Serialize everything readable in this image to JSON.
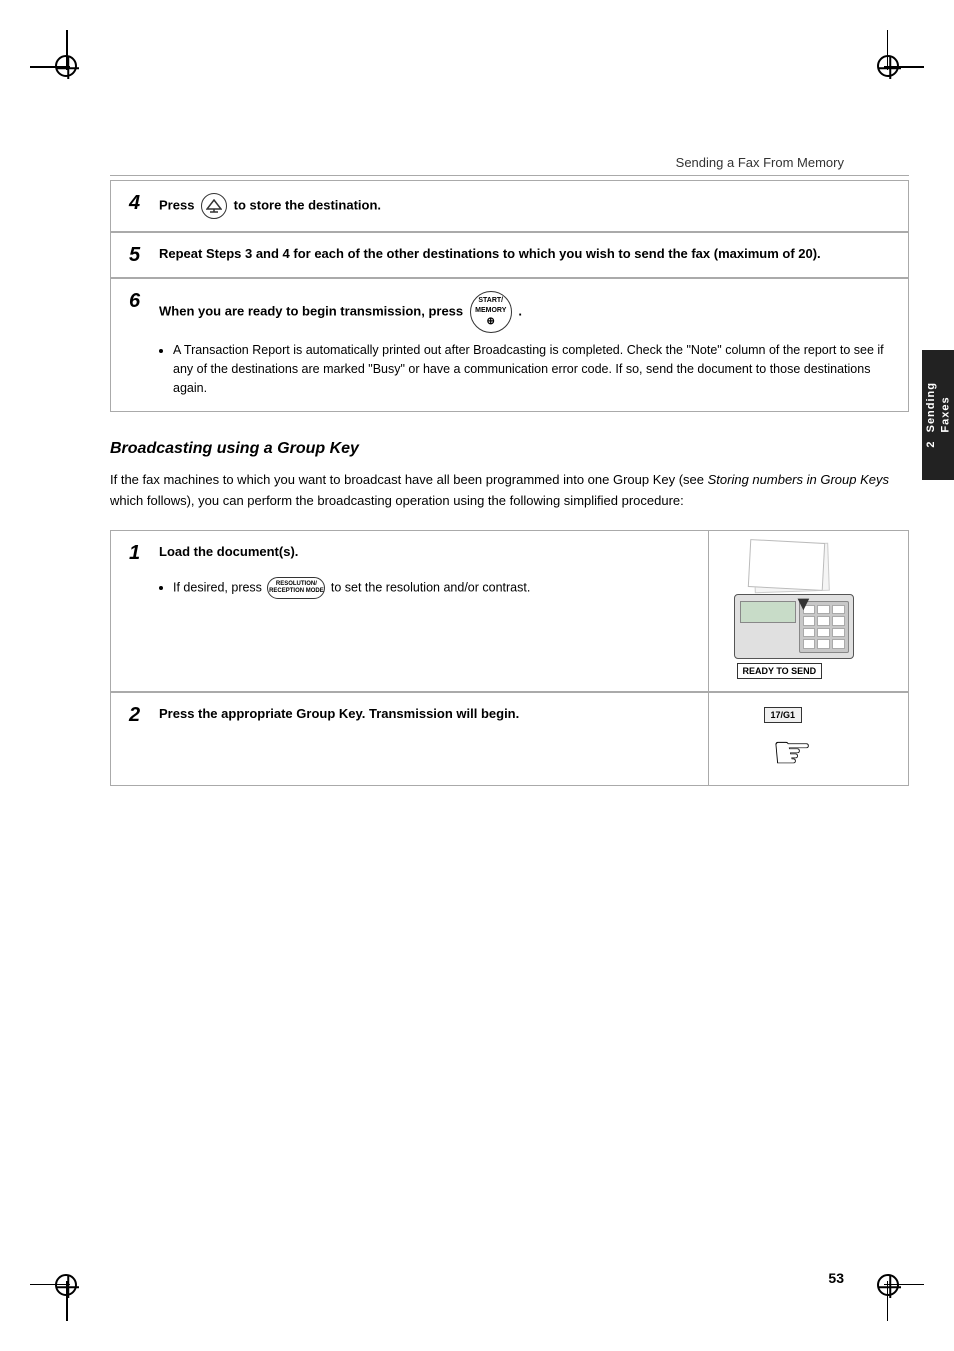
{
  "page": {
    "title": "Sending a Fax From Memory",
    "page_number": "53",
    "side_tab": "2  Sending\nFaxes"
  },
  "step4": {
    "number": "4",
    "instruction": "Press  to store the destination.",
    "instruction_prefix": "Press ",
    "instruction_suffix": " to store the destination."
  },
  "step5": {
    "number": "5",
    "instruction": "Repeat Steps 3 and 4 for each of the other destinations to which you wish to send the fax (maximum of 20)."
  },
  "step6": {
    "number": "6",
    "instruction_prefix": "When you are ready to begin transmission, press ",
    "instruction_suffix": ".",
    "bullet": "A Transaction Report is automatically printed out after Broadcasting is completed. Check the \"Note\" column of the report to see if any of the destinations are marked \"Busy\" or have a communication error code. If so, send the document to those destinations again."
  },
  "section": {
    "heading": "Broadcasting using a Group Key",
    "intro": "If the fax machines to which you want to broadcast have all been programmed into one Group Key (see Storing numbers in Group Keys which follows), you can perform the broadcasting operation using the following simplified procedure:"
  },
  "step1": {
    "number": "1",
    "instruction": "Load the document(s).",
    "bullet_prefix": "If desired, press ",
    "bullet_suffix": " to set the resolution and/or contrast.",
    "ready_to_send": "READY TO SEND"
  },
  "step2": {
    "number": "2",
    "instruction": "Press the appropriate Group Key. Transmission will begin.",
    "group_key_label": "17/G1"
  },
  "buttons": {
    "store_label": "STORE",
    "start_memory_line1": "START/",
    "start_memory_line2": "MEMORY",
    "resolution_line1": "RESOLUTION/",
    "resolution_line2": "RECEPTION MODE"
  }
}
